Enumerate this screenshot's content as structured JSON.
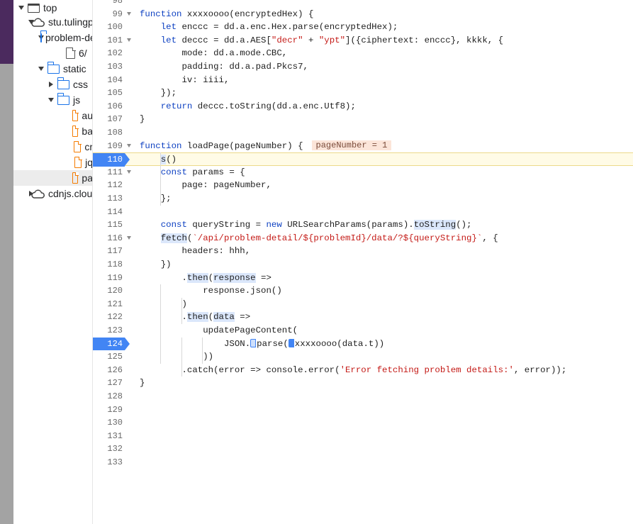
{
  "tree": {
    "items": [
      {
        "label": "top",
        "icon": "window-icon",
        "arrow": "down"
      },
      {
        "label": "stu.tulingpyton.cn",
        "icon": "cloud-icon",
        "arrow": "down"
      },
      {
        "label": "problem-detail",
        "icon": "folder-icon",
        "arrow": "down"
      },
      {
        "label": "6/",
        "icon": "document-icon",
        "arrow": ""
      },
      {
        "label": "static",
        "icon": "folder-icon",
        "arrow": "down"
      },
      {
        "label": "css",
        "icon": "folder-icon",
        "arrow": "right"
      },
      {
        "label": "js",
        "icon": "folder-icon",
        "arrow": "down"
      },
      {
        "label": "au",
        "icon": "js-file-icon",
        "arrow": ""
      },
      {
        "label": "ba",
        "icon": "js-file-icon",
        "arrow": ""
      },
      {
        "label": "cr",
        "icon": "js-file-icon",
        "arrow": ""
      },
      {
        "label": "jq",
        "icon": "js-file-icon",
        "arrow": ""
      },
      {
        "label": "pa",
        "icon": "js-file-icon",
        "arrow": "",
        "selected": true
      },
      {
        "label": "cdnjs.cloudflare.com",
        "icon": "cloud-icon",
        "arrow": "right"
      }
    ]
  },
  "editor": {
    "inline_value": "pageNumber = 1",
    "paused_line": 110,
    "breakpoint_lines": [
      110,
      124
    ],
    "lines": [
      {
        "n": "98",
        "text": ""
      },
      {
        "n": "99",
        "text": "function xxxxoooo(encryptedHex) {",
        "fold": true
      },
      {
        "n": "100",
        "text": "    let enccc = dd.a.enc.Hex.parse(encryptedHex);"
      },
      {
        "n": "101",
        "text": "    let deccc = dd.a.AES[\"decr\" + \"ypt\"]({ciphertext: enccc}, kkkk, {",
        "fold": true
      },
      {
        "n": "102",
        "text": "        mode: dd.a.mode.CBC,"
      },
      {
        "n": "103",
        "text": "        padding: dd.a.pad.Pkcs7,"
      },
      {
        "n": "104",
        "text": "        iv: iiii,"
      },
      {
        "n": "105",
        "text": "    });"
      },
      {
        "n": "106",
        "text": "    return deccc.toString(dd.a.enc.Utf8);"
      },
      {
        "n": "107",
        "text": "}"
      },
      {
        "n": "108",
        "text": ""
      },
      {
        "n": "109",
        "text": "function loadPage(pageNumber) {",
        "fold": true
      },
      {
        "n": "110",
        "text": "    s()"
      },
      {
        "n": "111",
        "text": "    const params = {",
        "fold": true
      },
      {
        "n": "112",
        "text": "        page: pageNumber,"
      },
      {
        "n": "113",
        "text": "    };"
      },
      {
        "n": "114",
        "text": ""
      },
      {
        "n": "115",
        "text": "    const queryString = new URLSearchParams(params).toString();"
      },
      {
        "n": "116",
        "text": "    fetch(`/api/problem-detail/${problemId}/data/?${queryString}`, {",
        "fold": true
      },
      {
        "n": "117",
        "text": "        headers: hhh,"
      },
      {
        "n": "118",
        "text": "    })"
      },
      {
        "n": "119",
        "text": "        .then(response =>"
      },
      {
        "n": "120",
        "text": "            response.json()"
      },
      {
        "n": "121",
        "text": "        )"
      },
      {
        "n": "122",
        "text": "        .then(data =>"
      },
      {
        "n": "123",
        "text": "            updatePageContent("
      },
      {
        "n": "124",
        "text": "                JSON.parse(xxxxoooo(data.t))"
      },
      {
        "n": "125",
        "text": "            ))"
      },
      {
        "n": "126",
        "text": "        .catch(error => console.error('Error fetching problem details:', error));"
      },
      {
        "n": "127",
        "text": "}"
      },
      {
        "n": "128",
        "text": ""
      },
      {
        "n": "129",
        "text": ""
      },
      {
        "n": "130",
        "text": ""
      },
      {
        "n": "131",
        "text": ""
      },
      {
        "n": "132",
        "text": ""
      },
      {
        "n": "133",
        "text": ""
      }
    ]
  },
  "colors": {
    "keyword": "#aa0d91",
    "string": "#c41a16",
    "breakpoint": "#4285f4",
    "paused_line_border": "#ecd98a"
  }
}
